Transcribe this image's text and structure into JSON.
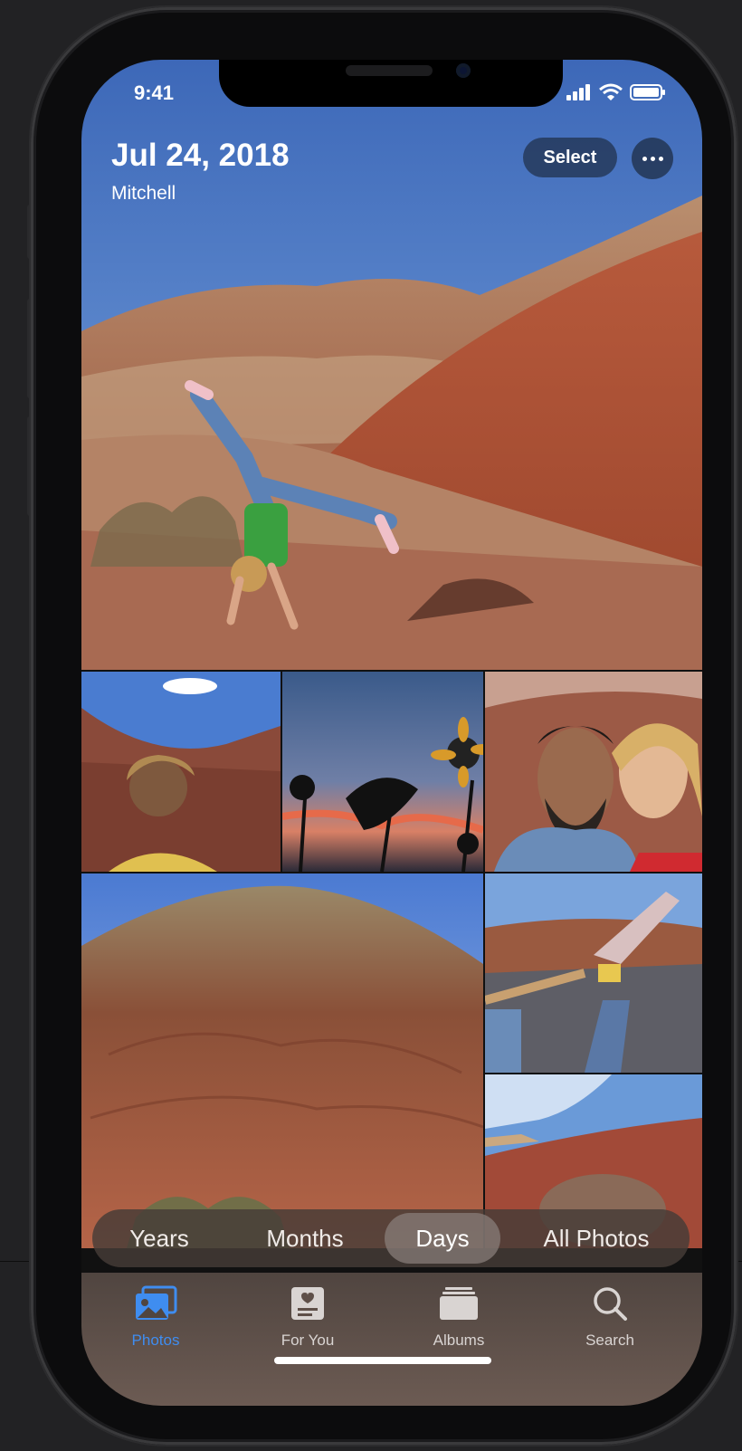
{
  "status": {
    "time": "9:41"
  },
  "header": {
    "date": "Jul 24, 2018",
    "location": "Mitchell"
  },
  "actions": {
    "select_label": "Select",
    "more_icon": "ellipsis-icon"
  },
  "segments": [
    {
      "label": "Years",
      "active": false
    },
    {
      "label": "Months",
      "active": false
    },
    {
      "label": "Days",
      "active": true
    },
    {
      "label": "All Photos",
      "active": false
    }
  ],
  "tabs": [
    {
      "label": "Photos",
      "icon": "photos-icon",
      "active": true
    },
    {
      "label": "For You",
      "icon": "for-you-icon",
      "active": false
    },
    {
      "label": "Albums",
      "icon": "albums-icon",
      "active": false
    },
    {
      "label": "Search",
      "icon": "search-icon",
      "active": false
    }
  ],
  "colors": {
    "accent": "#3f8df0",
    "tabbar": "#5e4f48"
  }
}
